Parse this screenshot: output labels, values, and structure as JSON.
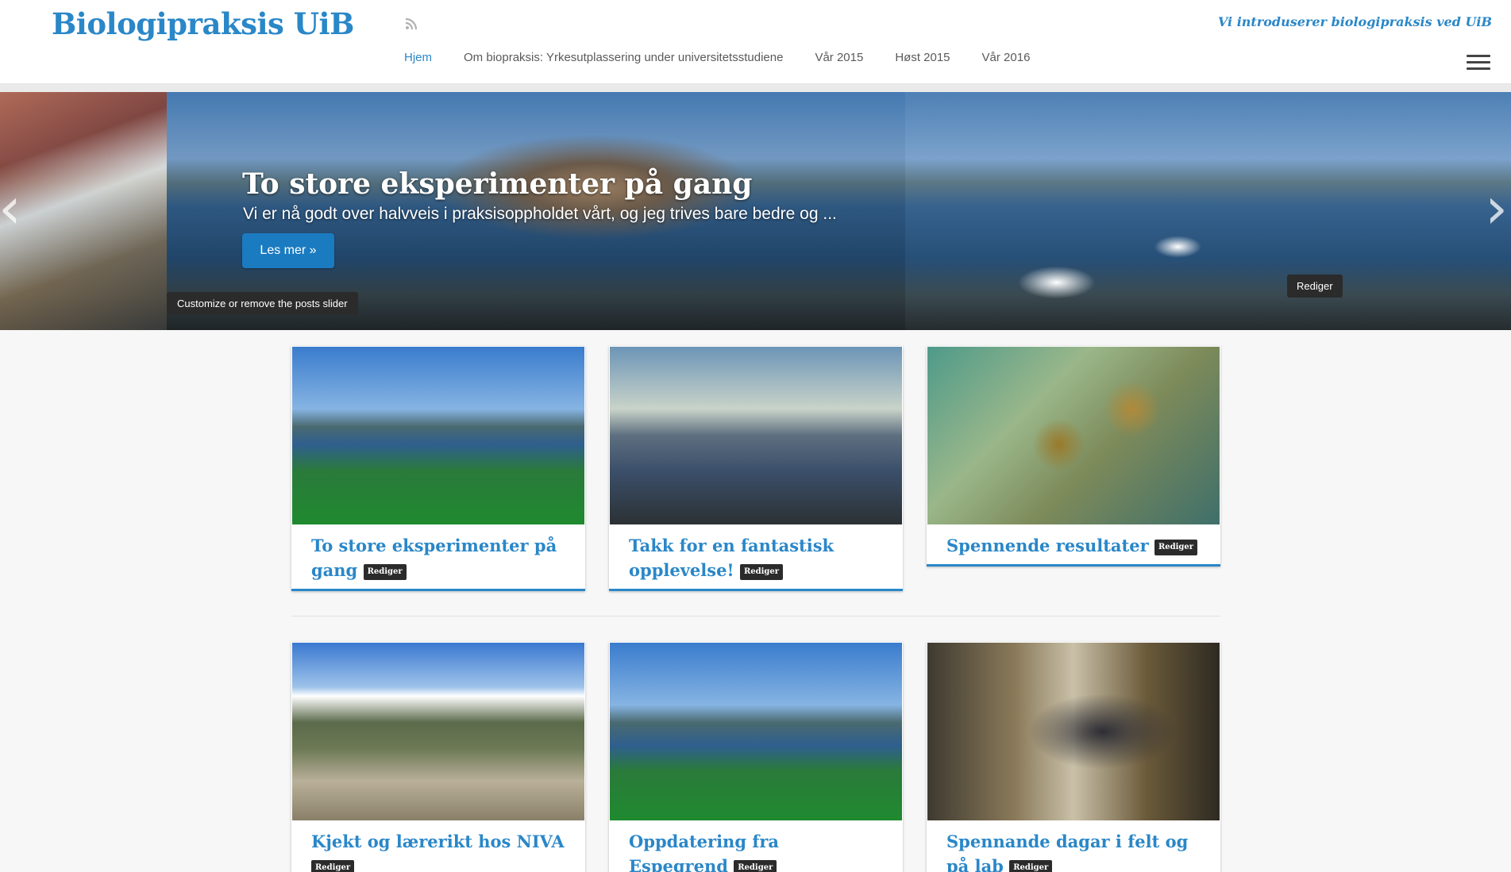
{
  "header": {
    "site_title": "Biologipraksis UiB",
    "tagline": "Vi introduserer biologipraksis ved UiB",
    "rss_icon": "rss-icon",
    "menu_icon": "hamburger-menu-icon",
    "brand_color": "#2a87c8",
    "nav": [
      {
        "label": "Hjem",
        "active": true
      },
      {
        "label": "Om biopraksis: Yrkesutplassering under universitetsstudiene",
        "active": false
      },
      {
        "label": "Vår 2015",
        "active": false
      },
      {
        "label": "Høst 2015",
        "active": false
      },
      {
        "label": "Vår 2016",
        "active": false
      }
    ]
  },
  "slider": {
    "title": "To store eksperimenter på gang",
    "excerpt": "Vi er nå godt over halvveis i praksisoppholdet vårt, og jeg trives bare bedre og ...",
    "button_label": "Les mer »",
    "customize_label": "Customize or remove the posts slider",
    "edit_label": "Rediger",
    "prev_icon": "‹",
    "next_icon": "›"
  },
  "posts": [
    {
      "title": "To store eksperimenter på gang",
      "edit_label": "Rediger"
    },
    {
      "title": "Takk for en fantastisk opplevelse!",
      "edit_label": "Rediger"
    },
    {
      "title": "Spennende resultater",
      "edit_label": "Rediger"
    },
    {
      "title": "Kjekt og lærerikt hos NIVA",
      "edit_label": "Rediger"
    },
    {
      "title": "Oppdatering fra Espegrend",
      "edit_label": "Rediger"
    },
    {
      "title": "Spennande dagar i felt og på lab",
      "edit_label": "Rediger"
    }
  ]
}
